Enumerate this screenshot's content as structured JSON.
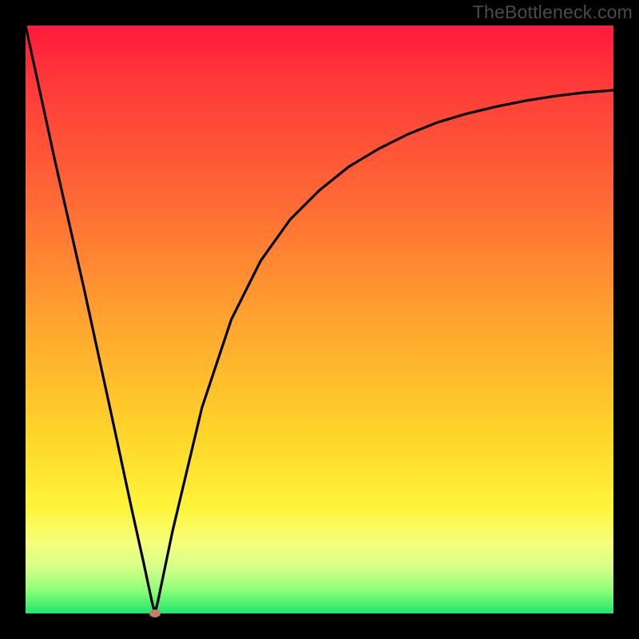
{
  "watermark": "TheBottleneck.com",
  "chart_data": {
    "type": "line",
    "title": "",
    "xlabel": "",
    "ylabel": "",
    "xlim": [
      0,
      100
    ],
    "ylim": [
      0,
      100
    ],
    "series": [
      {
        "name": "curve",
        "x": [
          0,
          5,
          10,
          15,
          18,
          20,
          21.5,
          22,
          22.5,
          25,
          30,
          35,
          40,
          45,
          50,
          55,
          60,
          65,
          70,
          75,
          80,
          85,
          90,
          95,
          100
        ],
        "values": [
          100,
          77,
          55,
          32,
          18,
          9,
          2,
          0,
          2,
          14,
          35,
          50,
          60,
          67,
          72,
          76,
          79,
          81.5,
          83.5,
          85,
          86.2,
          87.2,
          88,
          88.6,
          89
        ]
      }
    ],
    "marker": {
      "x": 22,
      "y": 0,
      "color": "#c77b6a"
    },
    "gradient_stops": [
      {
        "pos": 0,
        "color": "#ff1a3c"
      },
      {
        "pos": 10,
        "color": "#ff3a3a"
      },
      {
        "pos": 30,
        "color": "#ff6a35"
      },
      {
        "pos": 50,
        "color": "#ffa32f"
      },
      {
        "pos": 70,
        "color": "#ffd62a"
      },
      {
        "pos": 82,
        "color": "#fff43a"
      },
      {
        "pos": 88,
        "color": "#f6ff7a"
      },
      {
        "pos": 92,
        "color": "#d7ff8a"
      },
      {
        "pos": 96,
        "color": "#8eff7a"
      },
      {
        "pos": 100,
        "color": "#20e66a"
      }
    ]
  }
}
